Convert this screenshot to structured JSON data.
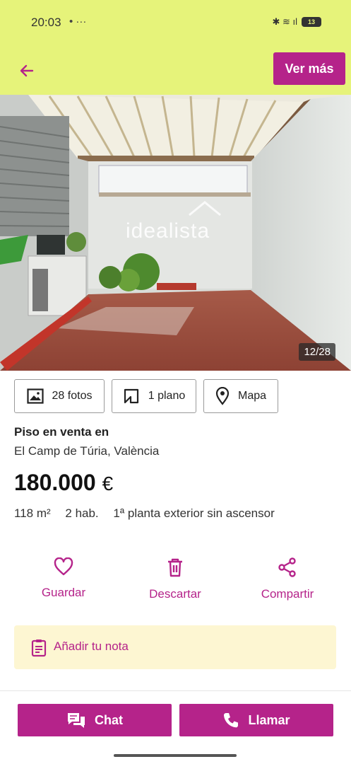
{
  "status": {
    "time": "20:03",
    "left_icons": "• ···",
    "right_icons": "✱ ≋ ıl",
    "battery": "13"
  },
  "header": {
    "back_icon": "arrow-left-icon",
    "ver_mas_label": "Ver más",
    "accent_color": "#b5238a",
    "bar_color": "#e6f37a"
  },
  "photo": {
    "counter": "12/28",
    "watermark": "idealista"
  },
  "media_buttons": [
    {
      "icon": "image-icon",
      "label": "28 fotos"
    },
    {
      "icon": "floor-plan-icon",
      "label": "1 plano"
    },
    {
      "icon": "map-pin-icon",
      "label": "Mapa"
    }
  ],
  "listing": {
    "title": "Piso en venta en",
    "location": "El Camp de Túria, València",
    "price": "180.000",
    "currency": "€",
    "area": "118 m²",
    "rooms": "2 hab.",
    "floor": "1ª planta exterior sin ascensor"
  },
  "actions": [
    {
      "icon": "heart-icon",
      "label": "Guardar"
    },
    {
      "icon": "trash-icon",
      "label": "Descartar"
    },
    {
      "icon": "share-icon",
      "label": "Compartir"
    }
  ],
  "note": {
    "icon": "note-icon",
    "label": "Añadir tu nota"
  },
  "bottom": {
    "chat_label": "Chat",
    "call_label": "Llamar"
  }
}
